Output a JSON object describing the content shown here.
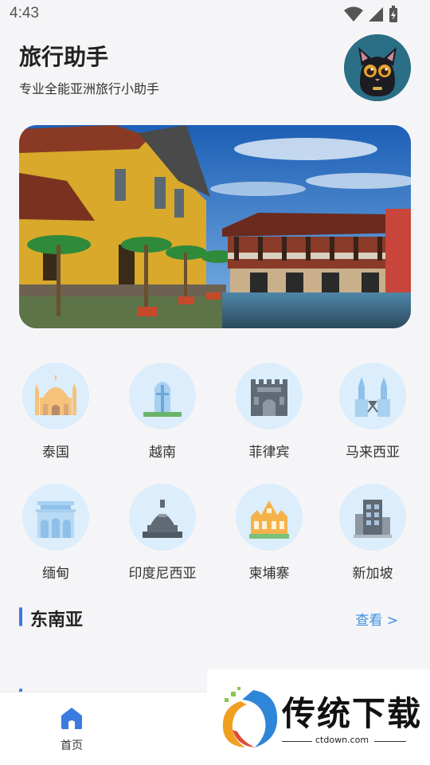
{
  "status_bar": {
    "time": "4:43"
  },
  "header": {
    "title": "旅行助手",
    "subtitle": "专业全能亚洲旅行小助手"
  },
  "countries": [
    {
      "label": "泰国",
      "icon": "temple-icon"
    },
    {
      "label": "越南",
      "icon": "tower-icon"
    },
    {
      "label": "菲律宾",
      "icon": "fortress-icon"
    },
    {
      "label": "马来西亚",
      "icon": "twin-towers-icon"
    },
    {
      "label": "缅甸",
      "icon": "palace-icon"
    },
    {
      "label": "印度尼西亚",
      "icon": "stupa-icon"
    },
    {
      "label": "柬埔寨",
      "icon": "angkor-icon"
    },
    {
      "label": "新加坡",
      "icon": "skyscraper-icon"
    }
  ],
  "section": {
    "title": "东南亚",
    "more": "查看 >"
  },
  "tab_bar": {
    "home_label": "首页"
  },
  "watermark": {
    "brand": "传统下载",
    "url": "ctdown.com"
  },
  "colors": {
    "accent": "#3b7be0",
    "icon_bg": "#dcedfb",
    "link": "#3b8fe0"
  }
}
